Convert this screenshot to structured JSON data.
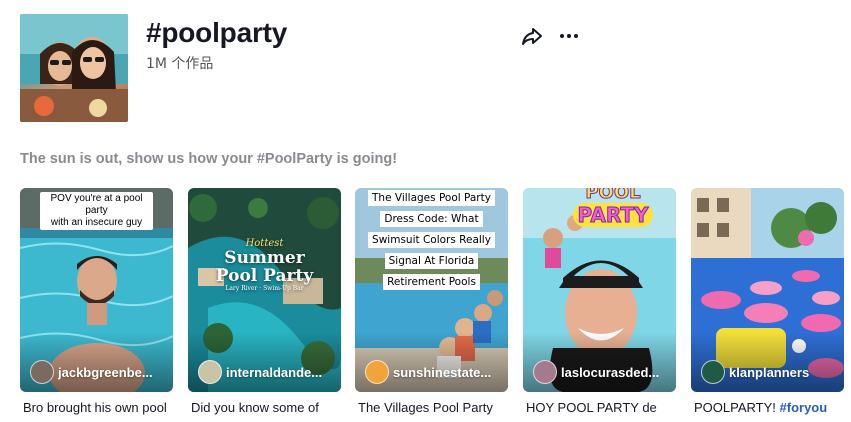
{
  "header": {
    "title": "#poolparty",
    "count": "1M 个作品",
    "share_icon": "share-icon",
    "more_icon": "more-icon"
  },
  "description": "The sun is out, show us how your #PoolParty is going!",
  "videos": [
    {
      "author": "jackbgreenbe...",
      "caption": "Bro brought his own pool",
      "overlay": [
        "POV you're at a pool party",
        "with an insecure guy"
      ]
    },
    {
      "author": "internaldande...",
      "caption": "Did you know some of",
      "overlay": [
        "Hottest",
        "Summer",
        "Pool Party",
        "Lary River · Swim-Up Bar"
      ]
    },
    {
      "author": "sunshinestate...",
      "caption": "The Villages Pool Party",
      "overlay": [
        "The Villages Pool Party",
        "Dress Code: What",
        "Swimsuit Colors Really",
        "Signal At Florida",
        "Retirement Pools"
      ]
    },
    {
      "author": "laslocurasded...",
      "caption": "HOY POOL PARTY de",
      "overlay": [
        "POOL",
        "PARTY"
      ]
    },
    {
      "author": "klanplanners",
      "caption": "POOLPARTY!",
      "caption_tag": "#foryou",
      "overlay": []
    }
  ],
  "colors": {
    "title": "#161823",
    "description": "#8a8b91",
    "hashtag_link": "#2b5db9"
  }
}
